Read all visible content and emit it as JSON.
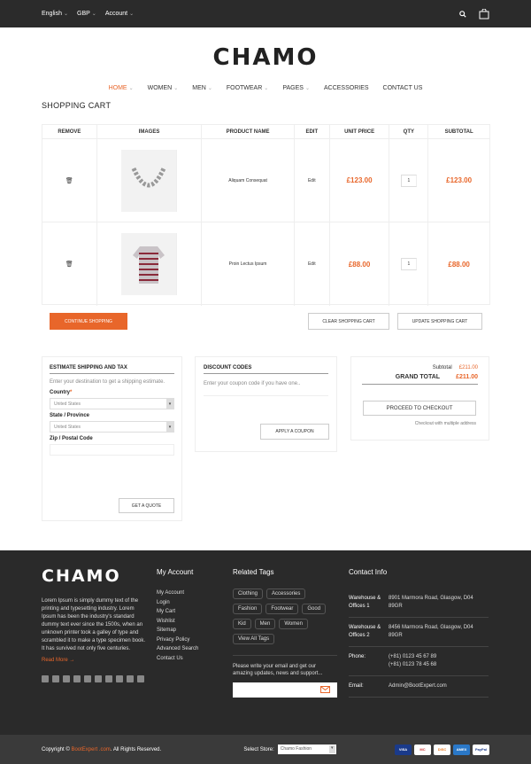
{
  "topbar": {
    "language": "English",
    "currency": "GBP",
    "account": "Account"
  },
  "brand": "CHAMO",
  "nav": [
    {
      "label": "HOME",
      "dropdown": true,
      "active": true
    },
    {
      "label": "WOMEN",
      "dropdown": true,
      "active": false
    },
    {
      "label": "MEN",
      "dropdown": true,
      "active": false
    },
    {
      "label": "FOOTWEAR",
      "dropdown": true,
      "active": false
    },
    {
      "label": "PAGES",
      "dropdown": true,
      "active": false
    },
    {
      "label": "ACCESSORIES",
      "dropdown": false,
      "active": false
    },
    {
      "label": "CONTACT US",
      "dropdown": false,
      "active": false
    }
  ],
  "page_title": "SHOPPING CART",
  "cart": {
    "headers": [
      "REMOVE",
      "IMAGES",
      "PRODUCT NAME",
      "EDIT",
      "UNIT PRICE",
      "QTY",
      "SUBTOTAL"
    ],
    "rows": [
      {
        "name": "Aliquam Consequat",
        "edit": "Edit",
        "unit_price": "£123.00",
        "qty": "1",
        "subtotal": "£123.00",
        "image": "necklace"
      },
      {
        "name": "Proin Lectus Ipsum",
        "edit": "Edit",
        "unit_price": "£88.00",
        "qty": "1",
        "subtotal": "£88.00",
        "image": "striped-shirt"
      }
    ],
    "continue_label": "CONTINUE SHOPPING",
    "clear_label": "CLEAR SHOPPING CART",
    "update_label": "UPDATE SHOPPING CART"
  },
  "shipping": {
    "title": "ESTIMATE SHIPPING AND TAX",
    "desc": "Enter your destination to get a shipping estimate.",
    "country_label": "Country",
    "required_mark": "*",
    "country_value": "United States",
    "state_label": "State / Province",
    "state_value": "United States",
    "zip_label": "Zip / Postal Code",
    "quote_label": "GET A QUOTE"
  },
  "discount": {
    "title": "DISCOUNT CODES",
    "desc": "Enter your coupon code if you have one..",
    "apply_label": "APPLY A COUPON"
  },
  "totals": {
    "subtotal_label": "Subtotal",
    "subtotal_value": "£211.00",
    "grand_label": "GRAND TOTAL",
    "grand_value": "£211.00",
    "checkout_label": "PROCEED TO CHECKOUT",
    "multi_label": "Checkout with multiple address"
  },
  "footer": {
    "brand": "CHAMO",
    "about": "Lorem Ipsum is simply dummy text of the printing and typesetting industry. Lorem Ipsum has been the industry's standard dummy text ever since the 1500s, when an unknown printer took a galley of type and scrambled it to make a type specimen book. It has survived not only five centuries.",
    "read_more": "Read More",
    "account_title": "My Account",
    "account_links": [
      "My Account",
      "Login",
      "My Cart",
      "Wishlist",
      "Sitemap",
      "Privacy Policy",
      "Advanced Search",
      "Contact Us"
    ],
    "tags_title": "Related Tags",
    "tags": [
      "Clothing",
      "Accessories",
      "Fashion",
      "Footwear",
      "Good",
      "Kid",
      "Men",
      "Women",
      "View All Tags"
    ],
    "newsletter_text": "Please write your email and get our amazing updates, news and support...",
    "contact_title": "Contact Info",
    "contacts": [
      {
        "key": "Warehouse & Offices 1",
        "value": "8901 Marmora Road, Glasgow, D04 89GR"
      },
      {
        "key": "Warehouse & Offices 2",
        "value": "8456 Marmora Road, Glasgow, D04 89GR"
      },
      {
        "key": "Phone:",
        "value": "(+81) 0123 45 67 89\n(+81) 0123 78 45 68",
        "orange": true
      },
      {
        "key": "Email:",
        "value": "Admin@BootExpert.com"
      }
    ]
  },
  "bottom": {
    "copyright_prefix": "Copyright ©",
    "copyright_brand": "BootExpert .com",
    "copyright_suffix": ". All Rights Reserved.",
    "store_label": "Select Store:",
    "store_value": "Chamo Fashion",
    "payments": [
      "VISA",
      "MC",
      "DISC",
      "AMEX",
      "PayPal"
    ]
  }
}
